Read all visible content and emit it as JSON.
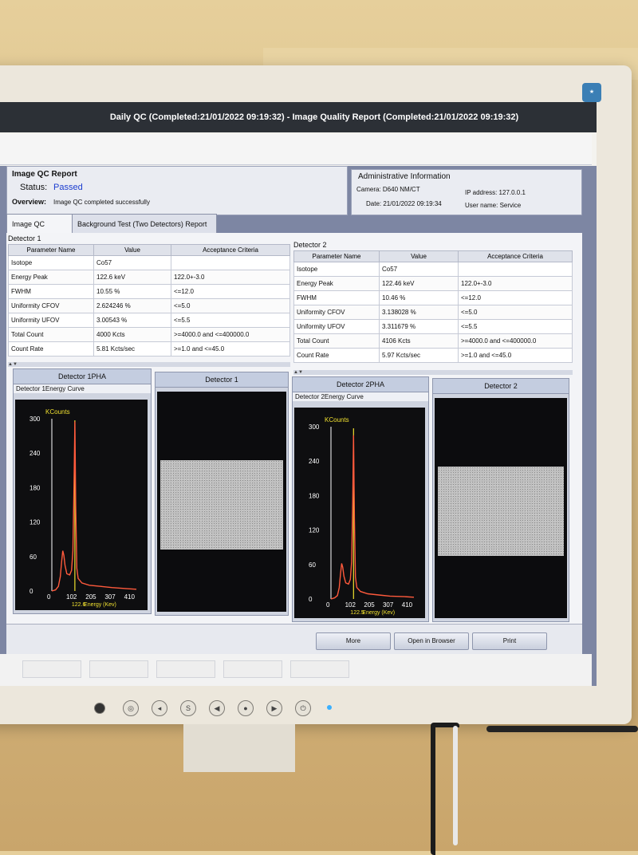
{
  "window": {
    "title": "Daily QC (Completed:21/01/2022 09:19:32)  - Image Quality Report  (Completed:21/01/2022 09:19:32)"
  },
  "qc_report": {
    "heading": "Image QC Report",
    "status_label": "Status:",
    "status_value": "Passed",
    "overview_label": "Overview:",
    "overview_value": "Image QC completed successfully"
  },
  "admin": {
    "heading": "Administrative Information",
    "camera": "Camera: D640 NM/CT",
    "ip": "IP address: 127.0.0.1",
    "date": "Date: 21/01/2022 09:19:34",
    "user": "User name: Service"
  },
  "tabs": [
    {
      "label": "Image QC Report"
    },
    {
      "label": "Background Test (Two Detectors)  Report"
    }
  ],
  "columns": [
    "Parameter Name",
    "Value",
    "Acceptance Criteria"
  ],
  "detector1": {
    "label": "Detector 1",
    "rows": [
      [
        "Isotope",
        "Co57",
        ""
      ],
      [
        "Energy Peak",
        "122.6 keV",
        "122.0+-3.0"
      ],
      [
        "FWHM",
        "10.55 %",
        "<=12.0"
      ],
      [
        "Uniformity CFOV",
        "2.624246 %",
        "<=5.0"
      ],
      [
        "Uniformity UFOV",
        "3.00543 %",
        "<=5.5"
      ],
      [
        "Total Count",
        "4000 Kcts",
        ">=4000.0 and <=400000.0"
      ],
      [
        "Count Rate",
        "5.81 Kcts/sec",
        ">=1.0 and <=45.0"
      ]
    ],
    "pha_header": "Detector 1PHA",
    "image_header": "Detector 1",
    "curve_title": "Detector 1Energy Curve",
    "peak_label": "122.6"
  },
  "detector2": {
    "label": "Detector 2",
    "rows": [
      [
        "Isotope",
        "Co57",
        ""
      ],
      [
        "Energy Peak",
        "122.46 keV",
        "122.0+-3.0"
      ],
      [
        "FWHM",
        "10.46 %",
        "<=12.0"
      ],
      [
        "Uniformity CFOV",
        "3.138028 %",
        "<=5.0"
      ],
      [
        "Uniformity UFOV",
        "3.311679 %",
        "<=5.5"
      ],
      [
        "Total Count",
        "4106 Kcts",
        ">=4000.0 and <=400000.0"
      ],
      [
        "Count Rate",
        "5.97 Kcts/sec",
        ">=1.0 and <=45.0"
      ]
    ],
    "pha_header": "Detector 2PHA",
    "image_header": "Detector 2",
    "curve_title": "Detector 2Energy Curve",
    "peak_label": "122.5"
  },
  "plot_axes": {
    "ylabel": "KCounts",
    "xlabel": "Energy (Kev)",
    "yticks": [
      "300",
      "240",
      "180",
      "120",
      "60",
      "0"
    ],
    "xticks": [
      "0",
      "102",
      "205",
      "307",
      "410"
    ]
  },
  "chart_data": [
    {
      "type": "line",
      "title": "Detector 1Energy Curve",
      "xlabel": "Energy (Kev)",
      "ylabel": "KCounts",
      "ylim": [
        0,
        300
      ],
      "xlim": [
        0,
        450
      ],
      "series": [
        {
          "x": [
            0,
            20,
            35,
            45,
            52,
            58,
            64,
            70,
            80,
            95,
            105,
            112,
            118,
            122.6,
            127,
            133,
            140,
            160,
            200,
            260,
            320,
            400,
            450
          ],
          "y": [
            0,
            2,
            8,
            25,
            50,
            70,
            62,
            45,
            30,
            28,
            36,
            70,
            180,
            295,
            150,
            40,
            22,
            14,
            10,
            8,
            6,
            4,
            3
          ]
        }
      ],
      "marker": {
        "x": 122.6,
        "label": "122.6"
      }
    },
    {
      "type": "line",
      "title": "Detector 2Energy Curve",
      "xlabel": "Energy (Kev)",
      "ylabel": "KCounts",
      "ylim": [
        0,
        300
      ],
      "xlim": [
        0,
        450
      ],
      "series": [
        {
          "x": [
            0,
            20,
            35,
            45,
            52,
            58,
            64,
            70,
            80,
            95,
            105,
            112,
            118,
            122.5,
            127,
            133,
            140,
            160,
            200,
            260,
            320,
            400,
            450
          ],
          "y": [
            0,
            2,
            6,
            20,
            44,
            62,
            55,
            40,
            28,
            26,
            34,
            65,
            170,
            285,
            140,
            38,
            20,
            13,
            9,
            7,
            5,
            4,
            3
          ]
        }
      ],
      "marker": {
        "x": 122.5,
        "label": "122.5"
      }
    }
  ],
  "buttons": {
    "more": "More",
    "open_browser": "Open in Browser",
    "print": "Print"
  },
  "colors": {
    "curve": "#ff5a3c",
    "marker": "#f0e030",
    "status": "#1a3ccf"
  }
}
